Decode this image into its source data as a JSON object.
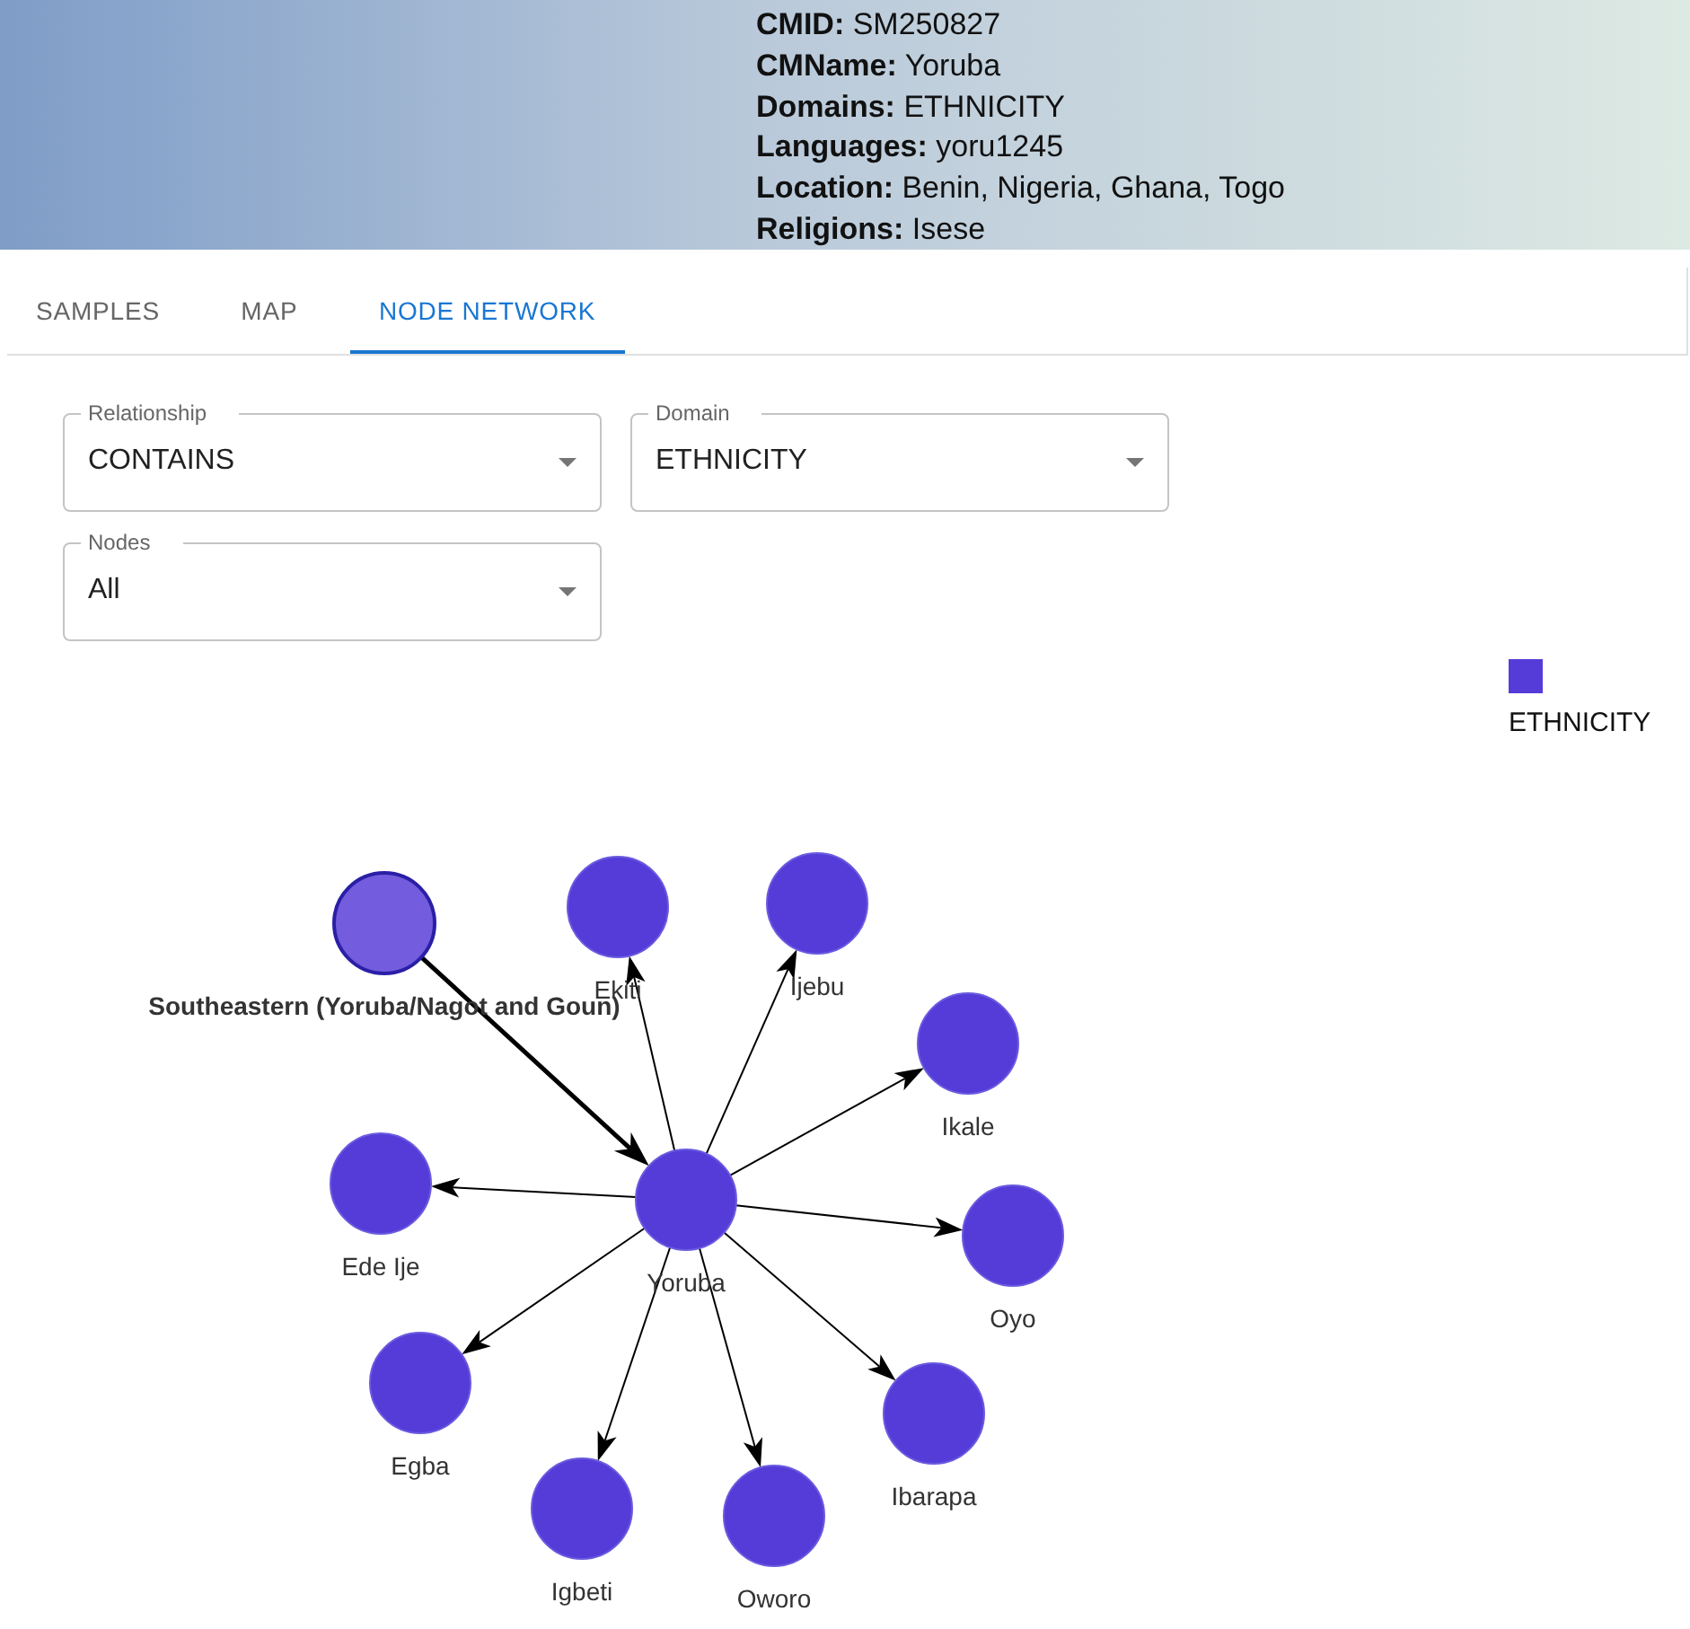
{
  "header": {
    "details": [
      {
        "label": "CMID:",
        "value": "SM250827"
      },
      {
        "label": "CMName:",
        "value": "Yoruba"
      },
      {
        "label": "Domains:",
        "value": "ETHNICITY"
      },
      {
        "label": "Languages:",
        "value": "yoru1245"
      },
      {
        "label": "Location:",
        "value": "Benin, Nigeria, Ghana, Togo"
      },
      {
        "label": "Religions:",
        "value": "Isese"
      }
    ]
  },
  "tabs": [
    {
      "label": "SAMPLES",
      "selected": false
    },
    {
      "label": "MAP",
      "selected": false
    },
    {
      "label": "NODE NETWORK",
      "selected": true
    }
  ],
  "filters": [
    {
      "label": "Relationship",
      "value": "CONTAINS"
    },
    {
      "label": "Domain",
      "value": "ETHNICITY"
    },
    {
      "label": "Nodes",
      "value": "All"
    }
  ],
  "legend": [
    {
      "label": "ETHNICITY",
      "color": "#553cd8"
    }
  ],
  "network": {
    "parent": {
      "label": "Southeastern (Yoruba/Nagot and Goun)",
      "highlighted": true
    },
    "center": {
      "label": "Yoruba",
      "highlighted": false
    },
    "children": [
      {
        "label": "Ekiti",
        "highlighted": false
      },
      {
        "label": "Ijebu",
        "highlighted": false
      },
      {
        "label": "Ikale",
        "highlighted": false
      },
      {
        "label": "Oyo",
        "highlighted": false
      },
      {
        "label": "Ibarapa",
        "highlighted": false
      },
      {
        "label": "Oworo",
        "highlighted": false
      },
      {
        "label": "Igbeti",
        "highlighted": false
      },
      {
        "label": "Egba",
        "highlighted": false
      },
      {
        "label": "Ede Ije",
        "highlighted": false
      }
    ]
  }
}
